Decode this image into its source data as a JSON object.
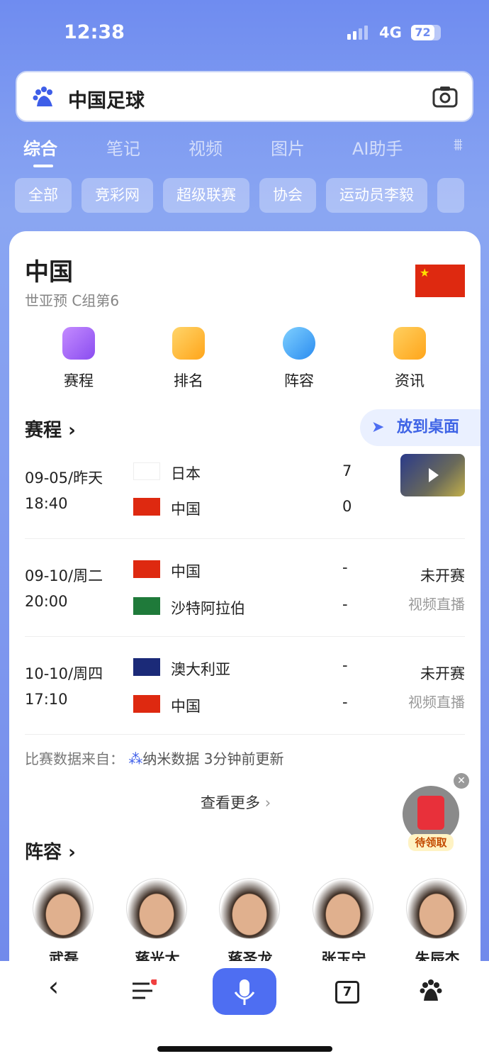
{
  "status": {
    "time": "12:38",
    "network": "4G",
    "battery": "72"
  },
  "search": {
    "query": "中国足球"
  },
  "tabs": [
    "综合",
    "笔记",
    "视频",
    "图片",
    "AI助手"
  ],
  "chips": [
    "全部",
    "竞彩网",
    "超级联赛",
    "协会",
    "运动员李毅"
  ],
  "card": {
    "team": "中国",
    "subtitle": "世亚预 C组第6",
    "quick": [
      "赛程",
      "排名",
      "阵容",
      "资讯"
    ],
    "schedule_title": "赛程",
    "pin_label": "放到桌面",
    "matches": [
      {
        "date": "09-05/昨天",
        "time": "18:40",
        "home": "日本",
        "away": "中国",
        "home_score": "7",
        "away_score": "0",
        "status": "",
        "broadcast": ""
      },
      {
        "date": "09-10/周二",
        "time": "20:00",
        "home": "中国",
        "away": "沙特阿拉伯",
        "home_score": "-",
        "away_score": "-",
        "status": "未开赛",
        "broadcast": "视频直播"
      },
      {
        "date": "10-10/周四",
        "time": "17:10",
        "home": "澳大利亚",
        "away": "中国",
        "home_score": "-",
        "away_score": "-",
        "status": "未开赛",
        "broadcast": "视频直播"
      }
    ],
    "source": "比赛数据来自：",
    "source_name": "纳米数据 3分钟前更新",
    "more": "查看更多",
    "lineup_title": "阵容",
    "players": [
      "武磊",
      "蒋光太",
      "蒋圣龙",
      "张玉宁",
      "朱辰杰"
    ]
  },
  "float": {
    "label": "待领取"
  },
  "bottom": {
    "tabs_count": "7"
  }
}
